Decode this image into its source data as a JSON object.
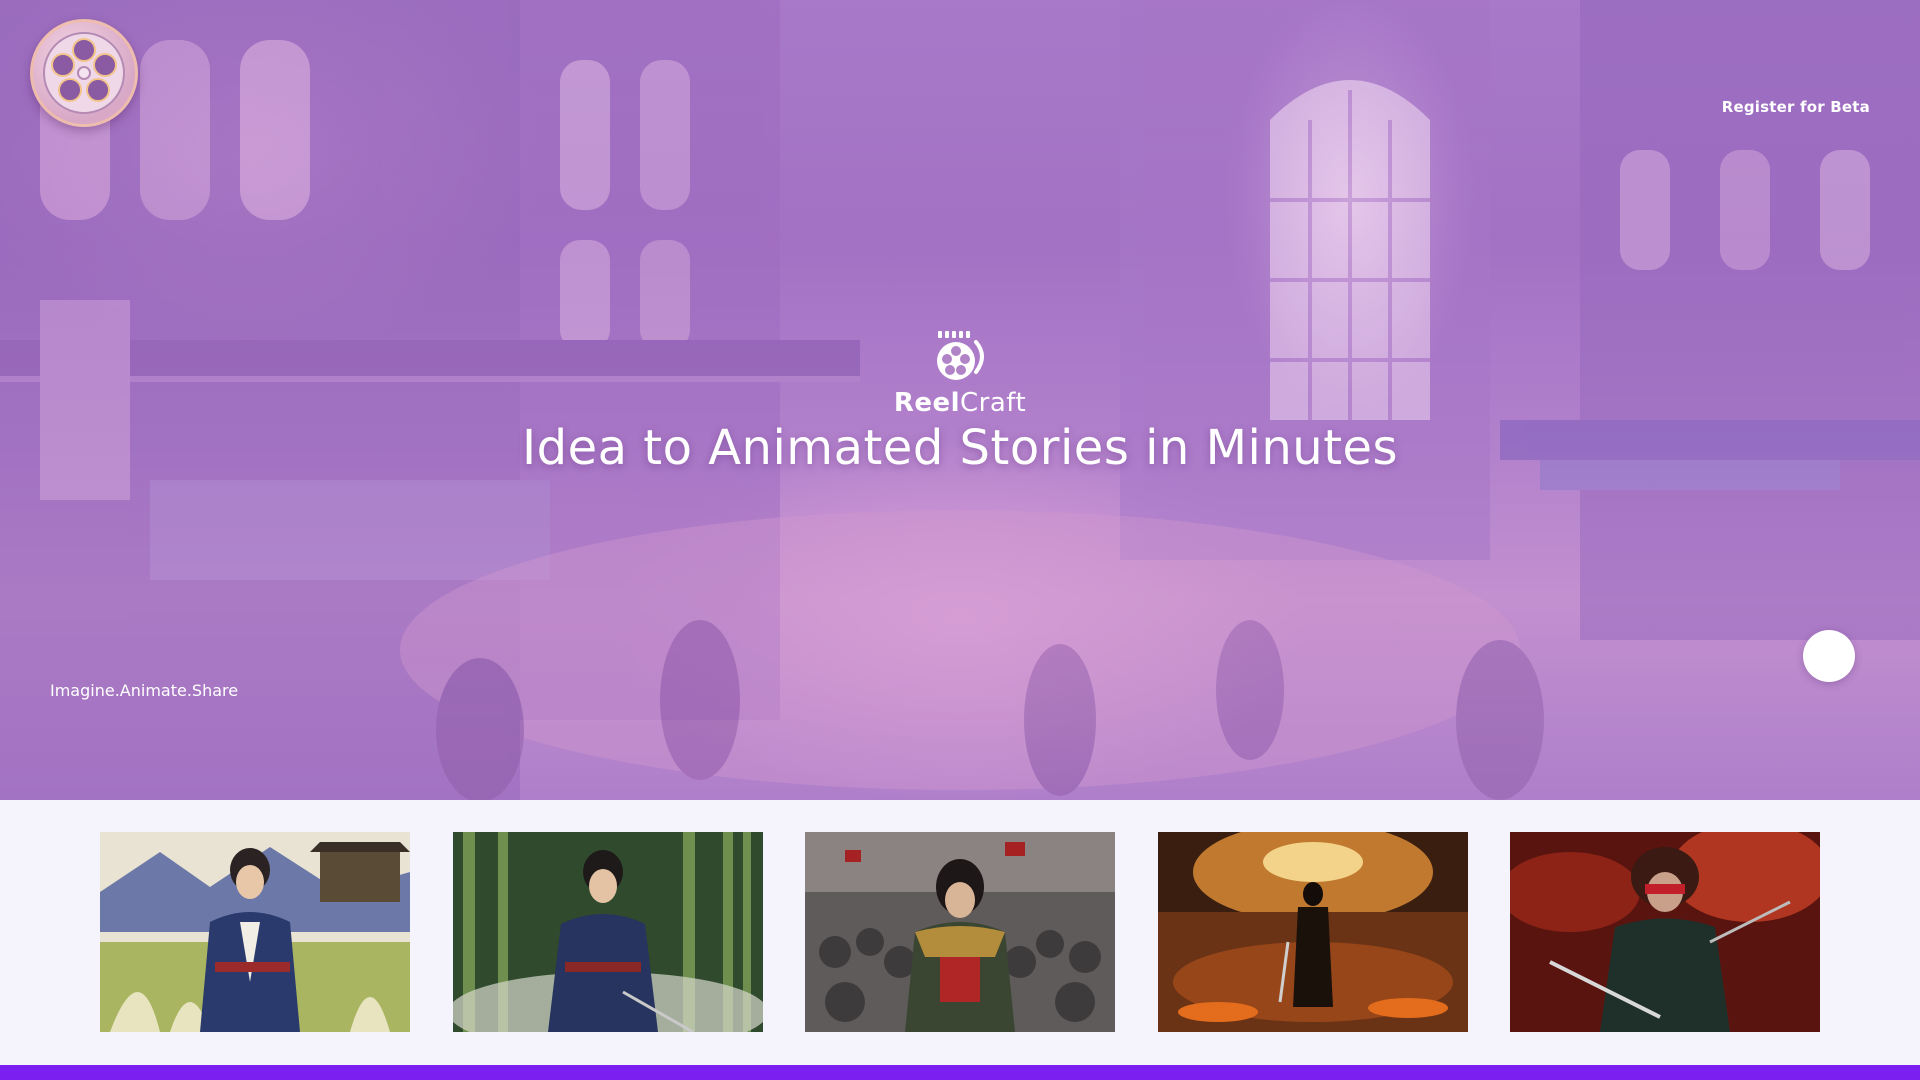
{
  "header": {
    "logo_icon": "film-reel-icon",
    "register_label": "Register for Beta"
  },
  "hero": {
    "brand": {
      "icon": "film-reel-icon",
      "name_part1": "Reel",
      "name_part2": "Craft"
    },
    "headline": "Idea to Animated Stories in Minutes",
    "tagline": "Imagine.Animate.Share"
  },
  "gallery": {
    "items": [
      {
        "icon": "samurai-in-meadow-image"
      },
      {
        "icon": "samurai-in-bamboo-image"
      },
      {
        "icon": "warrior-army-image"
      },
      {
        "icon": "warrior-in-fire-image"
      },
      {
        "icon": "masked-swordsman-image"
      }
    ]
  },
  "colors": {
    "accent_bar": "#7a1ff0",
    "hero_tint": "#a779c7",
    "gallery_bg": "#f5f3fb"
  }
}
